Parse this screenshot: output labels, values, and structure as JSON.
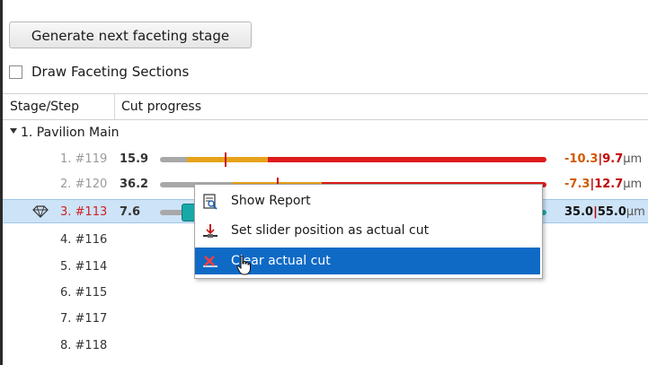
{
  "toolbar": {
    "generate_label": "Generate next faceting stage"
  },
  "options": {
    "draw_sections_label": "Draw Faceting Sections"
  },
  "table": {
    "columns": [
      "Stage/Step",
      "Cut progress"
    ],
    "group_label": "1. Pavilion Main",
    "rows": [
      {
        "step": "1. #119",
        "value": "15.9",
        "ra": "-10.3",
        "rb": "9.7",
        "unit": "µm"
      },
      {
        "step": "2. #120",
        "value": "36.2",
        "ra": "-7.3",
        "rb": "12.7",
        "unit": "µm"
      },
      {
        "step": "3. #113",
        "value": "7.6",
        "ra": "35.0",
        "rb": "55.0",
        "unit": "µm"
      },
      {
        "step": "4. #116"
      },
      {
        "step": "5. #114"
      },
      {
        "step": "6. #115"
      },
      {
        "step": "7. #117"
      },
      {
        "step": "8. #118"
      }
    ],
    "separator": "|"
  },
  "context_menu": {
    "items": [
      {
        "label": "Show Report",
        "icon": "report-icon"
      },
      {
        "label": "Set slider position as actual cut",
        "icon": "set-slider-icon"
      },
      {
        "label": "Clear actual cut",
        "icon": "clear-cut-icon"
      }
    ]
  },
  "colors": {
    "progress_gray": "#a8a8a8",
    "progress_yellow": "#e6a21a",
    "progress_red": "#dd1b1b",
    "selection": "#cde3f7",
    "menu_hover": "#0f6ac6",
    "slider_teal": "#19a8a8"
  }
}
